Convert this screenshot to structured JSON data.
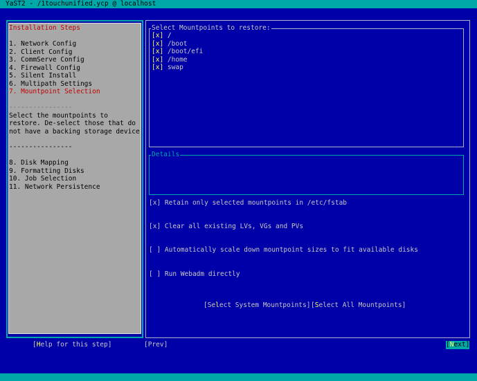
{
  "window": {
    "title": "YaST2 - /1touchunified.ycp @ localhost"
  },
  "sidebar": {
    "heading": "Installation Steps",
    "steps_before": [
      "1. Network Config",
      "2. Client Config",
      "3. CommServe Config",
      "4. Firewall Config",
      "5. Silent Install",
      "6. Multipath Settings"
    ],
    "current_step": "7. Mountpoint Selection",
    "separator1": "----------------",
    "help_lines": [
      "Select the mountpoints to",
      "restore. De-select those that do",
      "not have a backing storage device"
    ],
    "separator2": "----------------",
    "steps_after": [
      "8. Disk Mapping",
      "9. Formatting Disks",
      "10. Job Selection",
      "11. Network Persistence"
    ]
  },
  "mountpoints": {
    "title": "Select Mountpoints to restore:",
    "items": [
      {
        "check": "[x]",
        "label": "/"
      },
      {
        "check": "[x]",
        "label": "/boot"
      },
      {
        "check": "[x]",
        "label": "/boot/efi"
      },
      {
        "check": "[x]",
        "label": "/home"
      },
      {
        "check": "[x]",
        "label": "swap"
      }
    ]
  },
  "details": {
    "title": "Details"
  },
  "options": [
    {
      "check": "[x]",
      "label": "Retain only selected mountpoints in /etc/fstab",
      "checked": true
    },
    {
      "check": "[x]",
      "label": "Clear all existing LVs, VGs and PVs",
      "checked": true
    },
    {
      "check": "[ ]",
      "label": "Automatically scale down mountpoint sizes to fit available disks",
      "checked": false
    },
    {
      "check": "[ ]",
      "label": "Run Webadm directly",
      "checked": false
    }
  ],
  "buttons": {
    "select_system": {
      "pre": "[Se",
      "key": "l",
      "post": "ect System Mountpoints]"
    },
    "select_all": {
      "pre": "[",
      "key": "S",
      "post": "elect All Mountpoints]"
    },
    "help": {
      "pre": "[",
      "key": "H",
      "post": "elp for this step]"
    },
    "prev": "[Prev]",
    "next": {
      "pre": "[",
      "key": "N",
      "post": "ext]"
    }
  },
  "colors": {
    "background": "#0000a8",
    "accent": "#00a8a8",
    "panel": "#a8a8a8",
    "hotkey": "#ffff54",
    "current_step": "#c00000"
  }
}
